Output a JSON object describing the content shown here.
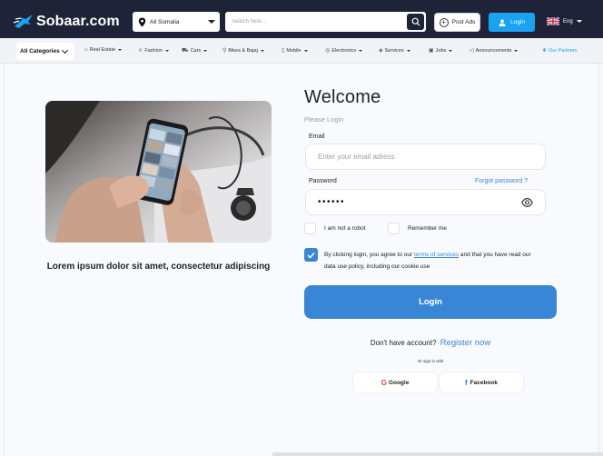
{
  "header": {
    "logo_text": "Sobaar.com",
    "location": "All Somalia",
    "search_placeholder": "Search here...",
    "post_ads_label": "Post Ads",
    "login_label": "Login",
    "language": "Eng",
    "colors": {
      "bar": "#1f2337",
      "login_button": "#1aa3f0"
    }
  },
  "categories": {
    "all_label": "All Categories",
    "items": [
      {
        "label": "Real Estate",
        "icon": "house-icon"
      },
      {
        "label": "Fashion",
        "icon": "hanger-icon"
      },
      {
        "label": "Cars",
        "icon": "car-icon"
      },
      {
        "label": "Bikes & Bajaj",
        "icon": "bike-icon"
      },
      {
        "label": "Mobile",
        "icon": "phone-icon"
      },
      {
        "label": "Electronics",
        "icon": "chip-icon"
      },
      {
        "label": "Services",
        "icon": "tag-icon"
      },
      {
        "label": "Jobs",
        "icon": "briefcase-icon"
      },
      {
        "label": "Announcements",
        "icon": "megaphone-icon"
      }
    ],
    "partners_label": "Our Partners"
  },
  "hero": {
    "tagline": "Lorem ipsum dolor sit amet, consectetur adipiscing"
  },
  "login_form": {
    "title": "Welcome",
    "subtitle": "Please Login",
    "email_label": "Email",
    "email_placeholder": "Enter your email adress",
    "password_label": "Password",
    "password_value": "••••••",
    "forgot_label": "Forgot password ?",
    "robot_label": "I am not a robot",
    "remember_label": "Remember me",
    "terms_before": "By clicking login, you agree to our ",
    "terms_link": "terms of services",
    "terms_after": " and that you have read our data use policy, including our cookie use",
    "submit_label": "Login",
    "no_account": "Don't have account?",
    "register_label": "Register now",
    "or_sign_in": "Or sign in with",
    "google_label": "Google",
    "facebook_label": "Facebook",
    "colors": {
      "accent": "#3a86d6"
    }
  }
}
